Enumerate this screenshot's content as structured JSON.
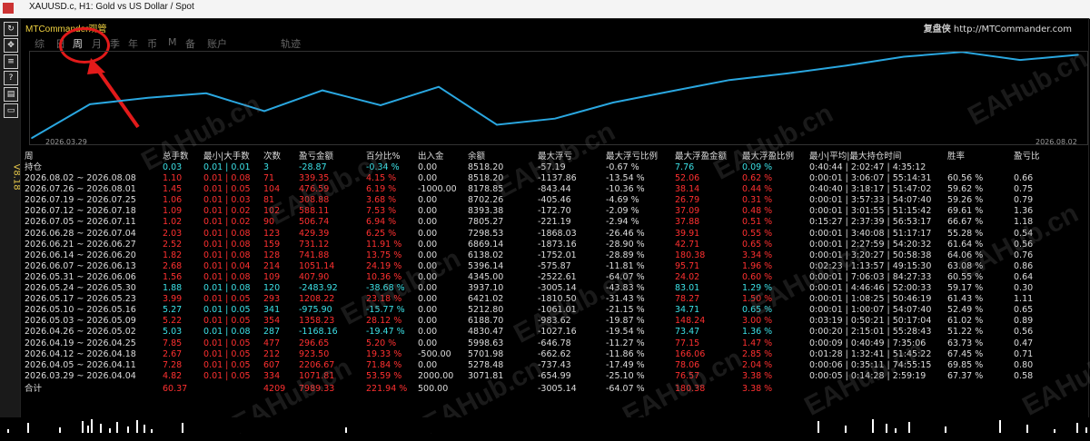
{
  "window": {
    "title": "XAUUSD.c, H1:  Gold vs US Dollar / Spot"
  },
  "brand": {
    "left": "MTCommander观管",
    "right_cn": "复盘侠",
    "right_url": "http://MTCommander.com"
  },
  "toolbar": {
    "version": "V8.18"
  },
  "tabs": [
    {
      "label": "综",
      "active": false
    },
    {
      "label": "日",
      "active": false
    },
    {
      "label": "周",
      "active": true
    },
    {
      "label": "月",
      "active": false
    },
    {
      "label": "季",
      "active": false
    },
    {
      "label": "年",
      "active": false
    },
    {
      "label": "币",
      "active": false
    },
    {
      "label": "M",
      "active": false
    },
    {
      "label": "备",
      "active": false
    },
    {
      "label": "账户",
      "active": false
    },
    {
      "label": "轨迹",
      "active": false
    }
  ],
  "chart_data": {
    "type": "line",
    "x_start_label": "2026.03.29",
    "x_end_label": "2026.08.02",
    "series": [
      {
        "values": [
          3071.81,
          5278.48,
          5701.98,
          5998.63,
          4830.47,
          6188.7,
          5212.8,
          6421.02,
          3937.1,
          4345.0,
          5396.14,
          6138.02,
          6869.14,
          7298.53,
          7805.27,
          8393.38,
          8702.26,
          8178.85,
          8518.2
        ]
      }
    ],
    "color": "#2aa7e0"
  },
  "table": {
    "headers": [
      "周",
      "总手数",
      "最小|大手数",
      "次数",
      "盈亏金额",
      "百分比%",
      "出入金",
      "余额",
      "最大浮亏",
      "最大浮亏比例",
      "最大浮盈金额",
      "最大浮盈比例",
      "最小|平均|最大持仓时间",
      "胜率",
      "盈亏比"
    ],
    "open_row": [
      "持仓",
      "0.03",
      "0.01 | 0.01",
      "3",
      "-28.87",
      "-0.34 %",
      "0.00",
      "8518.20",
      "-57.19",
      "-0.67 %",
      "7.76",
      "0.09 %",
      "0:40:44 | 2:02:47 | 4:35:12",
      "",
      ""
    ],
    "rows": [
      [
        "2026.08.02 ~ 2026.08.08",
        "1.10",
        "0.01 | 0.08",
        "71",
        "339.35",
        "4.15 %",
        "0.00",
        "8518.20",
        "-1137.86",
        "-13.54 %",
        "52.06",
        "0.62 %",
        "0:00:01 | 3:06:07 | 55:14:31",
        "60.56 %",
        "0.66"
      ],
      [
        "2026.07.26 ~ 2026.08.01",
        "1.45",
        "0.01 | 0.05",
        "104",
        "476.59",
        "6.19 %",
        "-1000.00",
        "8178.85",
        "-843.44",
        "-10.36 %",
        "38.14",
        "0.44 %",
        "0:40:40 | 3:18:17 | 51:47:02",
        "59.62 %",
        "0.75"
      ],
      [
        "2026.07.19 ~ 2026.07.25",
        "1.06",
        "0.01 | 0.03",
        "81",
        "308.88",
        "3.68 %",
        "0.00",
        "8702.26",
        "-405.46",
        "-4.69 %",
        "26.79",
        "0.31 %",
        "0:00:01 | 3:57:33 | 54:07:40",
        "59.26 %",
        "0.79"
      ],
      [
        "2026.07.12 ~ 2026.07.18",
        "1.09",
        "0.01 | 0.02",
        "102",
        "588.11",
        "7.53 %",
        "0.00",
        "8393.38",
        "-172.70",
        "-2.09 %",
        "37.09",
        "0.48 %",
        "0:00:01 | 3:01:55 | 51:15:42",
        "69.61 %",
        "1.36"
      ],
      [
        "2026.07.05 ~ 2026.07.11",
        "1.02",
        "0.01 | 0.02",
        "90",
        "506.74",
        "6.94 %",
        "0.00",
        "7805.27",
        "-221.19",
        "-2.94 %",
        "37.88",
        "0.51 %",
        "0:15:27 | 2:37:39 | 56:53:17",
        "66.67 %",
        "1.18"
      ],
      [
        "2026.06.28 ~ 2026.07.04",
        "2.03",
        "0.01 | 0.08",
        "123",
        "429.39",
        "6.25 %",
        "0.00",
        "7298.53",
        "-1868.03",
        "-26.46 %",
        "39.91",
        "0.55 %",
        "0:00:01 | 3:40:08 | 51:17:17",
        "55.28 %",
        "0.54"
      ],
      [
        "2026.06.21 ~ 2026.06.27",
        "2.52",
        "0.01 | 0.08",
        "159",
        "731.12",
        "11.91 %",
        "0.00",
        "6869.14",
        "-1873.16",
        "-28.90 %",
        "42.71",
        "0.65 %",
        "0:00:01 | 2:27:59 | 54:20:32",
        "61.64 %",
        "0.56"
      ],
      [
        "2026.06.14 ~ 2026.06.20",
        "1.82",
        "0.01 | 0.08",
        "128",
        "741.88",
        "13.75 %",
        "0.00",
        "6138.02",
        "-1752.01",
        "-28.89 %",
        "180.38",
        "3.34 %",
        "0:00:01 | 3:20:27 | 50:58:38",
        "64.06 %",
        "0.76"
      ],
      [
        "2026.06.07 ~ 2026.06.13",
        "2.68",
        "0.01 | 0.04",
        "214",
        "1051.14",
        "24.19 %",
        "0.00",
        "5396.14",
        "-575.87",
        "-11.81 %",
        "95.71",
        "1.96 %",
        "0:02:23 | 1:13:57 | 49:15:30",
        "63.08 %",
        "0.86"
      ],
      [
        "2026.05.31 ~ 2026.06.06",
        "1.56",
        "0.01 | 0.08",
        "109",
        "407.90",
        "10.36 %",
        "0.00",
        "4345.00",
        "-2522.61",
        "-64.07 %",
        "24.02",
        "0.60 %",
        "0:00:01 | 7:06:03 | 84:27:33",
        "60.55 %",
        "0.64"
      ],
      [
        "2026.05.24 ~ 2026.05.30",
        "1.88",
        "0.01 | 0.08",
        "120",
        "-2483.92",
        "-38.68 %",
        "0.00",
        "3937.10",
        "-3005.14",
        "-43.83 %",
        "83.01",
        "1.29 %",
        "0:00:01 | 4:46:46 | 52:00:33",
        "59.17 %",
        "0.30"
      ],
      [
        "2026.05.17 ~ 2026.05.23",
        "3.99",
        "0.01 | 0.05",
        "293",
        "1208.22",
        "23.18 %",
        "0.00",
        "6421.02",
        "-1810.50",
        "-31.43 %",
        "78.27",
        "1.50 %",
        "0:00:01 | 1:08:25 | 50:46:19",
        "61.43 %",
        "1.11"
      ],
      [
        "2026.05.10 ~ 2026.05.16",
        "5.27",
        "0.01 | 0.05",
        "341",
        "-975.90",
        "-15.77 %",
        "0.00",
        "5212.80",
        "-1061.01",
        "-21.15 %",
        "34.71",
        "0.65 %",
        "0:00:01 | 1:00:07 | 54:07:40",
        "52.49 %",
        "0.65"
      ],
      [
        "2026.05.03 ~ 2026.05.09",
        "5.22",
        "0.01 | 0.05",
        "354",
        "1358.23",
        "28.12 %",
        "0.00",
        "6188.70",
        "-983.62",
        "-19.87 %",
        "148.24",
        "3.00 %",
        "0:03:19 | 0:50:21 | 50:17:04",
        "61.02 %",
        "0.89"
      ],
      [
        "2026.04.26 ~ 2026.05.02",
        "5.03",
        "0.01 | 0.08",
        "287",
        "-1168.16",
        "-19.47 %",
        "0.00",
        "4830.47",
        "-1027.16",
        "-19.54 %",
        "73.47",
        "1.36 %",
        "0:00:20 | 2:15:01 | 55:28:43",
        "51.22 %",
        "0.56"
      ],
      [
        "2026.04.19 ~ 2026.04.25",
        "7.85",
        "0.01 | 0.05",
        "477",
        "296.65",
        "5.20 %",
        "0.00",
        "5998.63",
        "-646.78",
        "-11.27 %",
        "77.15",
        "1.47 %",
        "0:00:09 | 0:40:49 | 7:35:06",
        "63.73 %",
        "0.47"
      ],
      [
        "2026.04.12 ~ 2026.04.18",
        "2.67",
        "0.01 | 0.05",
        "212",
        "923.50",
        "19.33 %",
        "-500.00",
        "5701.98",
        "-662.62",
        "-11.86 %",
        "166.06",
        "2.85 %",
        "0:01:28 | 1:32:41 | 51:45:22",
        "67.45 %",
        "0.71"
      ],
      [
        "2026.04.05 ~ 2026.04.11",
        "7.28",
        "0.01 | 0.05",
        "607",
        "2206.67",
        "71.84 %",
        "0.00",
        "5278.48",
        "-737.43",
        "-17.49 %",
        "78.06",
        "2.04 %",
        "0:00:06 | 0:35:11 | 74:55:15",
        "69.85 %",
        "0.80"
      ],
      [
        "2026.03.29 ~ 2026.04.04",
        "4.82",
        "0.01 | 0.05",
        "334",
        "1071.81",
        "53.59 %",
        "2000.00",
        "3071.81",
        "-654.99",
        "-25.10 %",
        "76.57",
        "3.38 %",
        "0:00:05 | 0:14:28 | 2:59:19",
        "67.37 %",
        "0.58"
      ]
    ],
    "total_row": [
      "合计",
      "60.37",
      "",
      "4209",
      "7989.33",
      "221.94 %",
      "500.00",
      "",
      "-3005.14",
      "-64.07 %",
      "180.38",
      "3.38 %",
      "",
      "",
      ""
    ]
  },
  "watermark": "EAHub.cn"
}
